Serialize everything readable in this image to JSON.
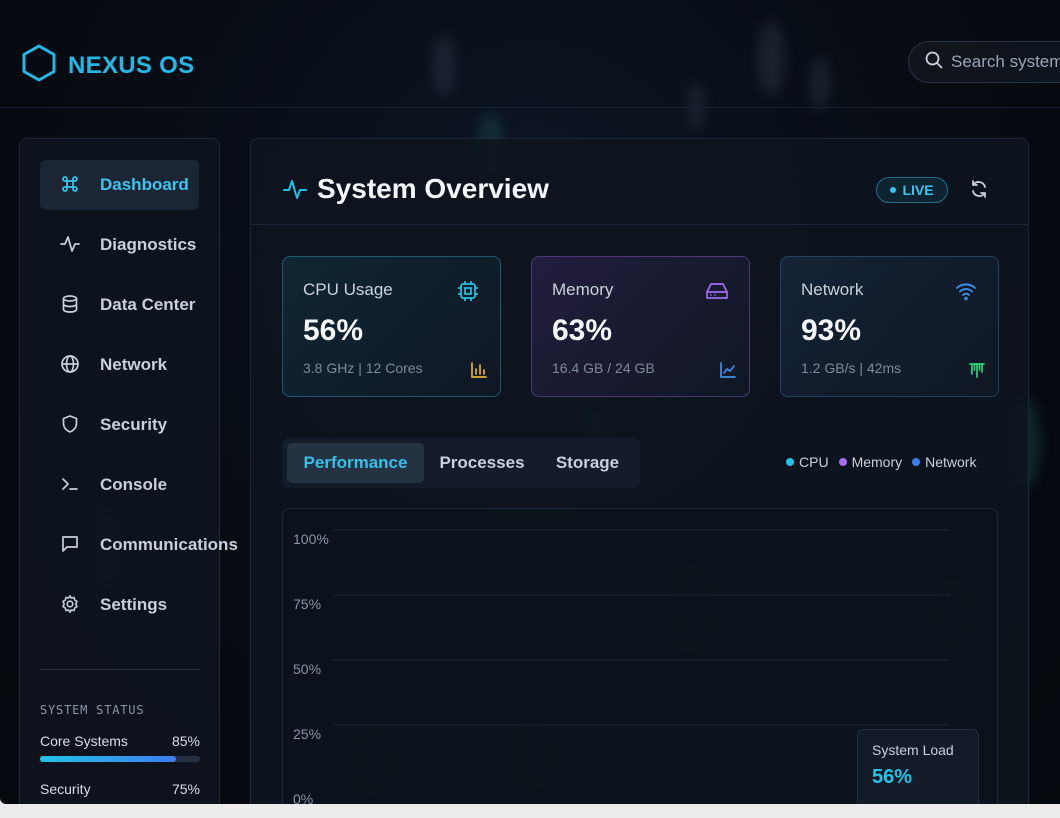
{
  "app": {
    "name": "NEXUS OS",
    "accent": "#22b8e8"
  },
  "search": {
    "placeholder": "Search system..."
  },
  "sidebar": {
    "items": [
      {
        "label": "Dashboard",
        "icon": "command-icon",
        "active": true
      },
      {
        "label": "Diagnostics",
        "icon": "activity-icon"
      },
      {
        "label": "Data Center",
        "icon": "database-icon"
      },
      {
        "label": "Network",
        "icon": "globe-icon"
      },
      {
        "label": "Security",
        "icon": "shield-icon"
      },
      {
        "label": "Console",
        "icon": "terminal-icon"
      },
      {
        "label": "Communications",
        "icon": "message-icon"
      },
      {
        "label": "Settings",
        "icon": "gear-icon"
      }
    ],
    "status": {
      "title": "SYSTEM STATUS",
      "rows": [
        {
          "label": "Core Systems",
          "value": "85%",
          "level": 0.85
        },
        {
          "label": "Security",
          "value": "75%",
          "level": 0.75
        }
      ]
    }
  },
  "main": {
    "title": "System Overview",
    "live_label": "LIVE",
    "cards": [
      {
        "label": "CPU Usage",
        "value": "56%",
        "sub": "3.8 GHz | 12 Cores",
        "icon": "cpu-icon",
        "mini_icon": "bar-chart-icon",
        "color": "#22c3e6",
        "mini_color": "#e0b23a"
      },
      {
        "label": "Memory",
        "value": "63%",
        "sub": "16.4 GB / 24 GB",
        "icon": "hard-drive-icon",
        "mini_icon": "line-chart-icon",
        "color": "#a66cf0",
        "mini_color": "#3c8ff0"
      },
      {
        "label": "Network",
        "value": "93%",
        "sub": "1.2 GB/s | 42ms",
        "icon": "wifi-icon",
        "mini_icon": "signal-icon",
        "color": "#3c8ff0",
        "mini_color": "#2fd07a"
      }
    ],
    "tabs": [
      "Performance",
      "Processes",
      "Storage"
    ],
    "legend": [
      {
        "label": "CPU",
        "color": "#22c3e6"
      },
      {
        "label": "Memory",
        "color": "#a66cf0"
      },
      {
        "label": "Network",
        "color": "#3c7df0"
      }
    ],
    "chart_data": {
      "type": "line",
      "ylabels": [
        "100%",
        "75%",
        "50%",
        "25%",
        "0%"
      ],
      "ylim": [
        0,
        100
      ],
      "grid": true
    },
    "load": {
      "label": "System Load",
      "value": "56%"
    }
  }
}
